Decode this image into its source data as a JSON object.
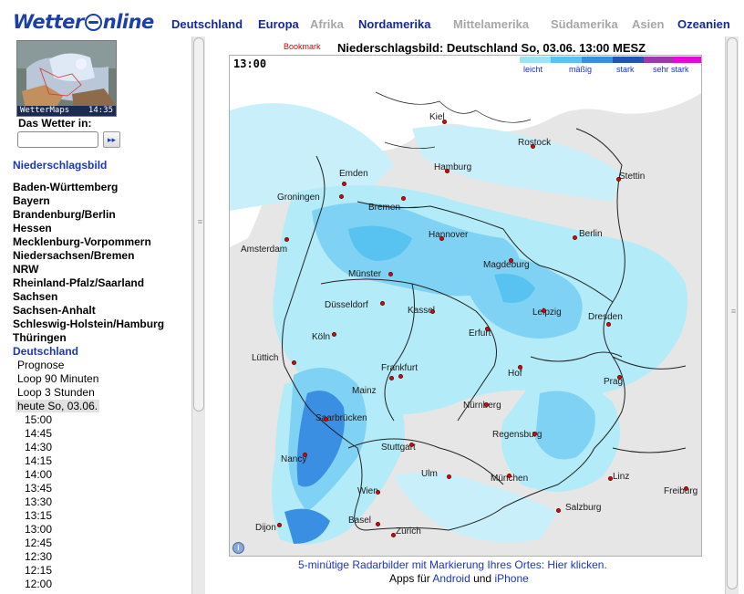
{
  "header": {
    "logo": "WetterOnline",
    "nav": [
      {
        "label": "Deutschland",
        "active": true
      },
      {
        "label": "Europa",
        "active": true
      },
      {
        "label": "Afrika",
        "active": false
      },
      {
        "label": "Nordamerika",
        "active": true
      },
      {
        "label": "Mittelamerika",
        "active": false
      },
      {
        "label": "Südamerika",
        "active": false
      },
      {
        "label": "Asien",
        "active": false
      },
      {
        "label": "Ozeanien",
        "active": true
      }
    ]
  },
  "sidebar": {
    "thumbnail": {
      "caption_left": "WetterMaps",
      "caption_right": "14:35"
    },
    "search_label": "Das Wetter in:",
    "search_value": "",
    "go_button": "▸▸",
    "section_title": "Niederschlagsbild",
    "regions": [
      "Baden-Württemberg",
      "Bayern",
      "Brandenburg/Berlin",
      "Hessen",
      "Mecklenburg-Vorpommern",
      "Niedersachsen/Bremen",
      "NRW",
      "Rheinland-Pfalz/Saarland",
      "Sachsen",
      "Sachsen-Anhalt",
      "Schleswig-Holstein/Hamburg",
      "Thüringen"
    ],
    "current_region": "Deutschland",
    "sub_items": [
      "Prognose",
      "Loop 90 Minuten",
      "Loop 3 Stunden"
    ],
    "selected_day": "heute So, 03.06.",
    "times": [
      "15:00",
      "14:45",
      "14:30",
      "14:15",
      "14:00",
      "13:45",
      "13:30",
      "13:15",
      "13:00",
      "12:45",
      "12:30",
      "12:15",
      "12:00"
    ]
  },
  "main": {
    "bookmark": "Bookmark",
    "title": "Niederschlagsbild: Deutschland So, 03.06. 13:00 MESZ",
    "map_time": "13:00",
    "legend": {
      "labels": [
        "leicht",
        "mäßig",
        "stark",
        "sehr stark"
      ],
      "colors": [
        "#9fe4f5",
        "#58c2f0",
        "#3a8fe3",
        "#2352b8",
        "#9b3aa8",
        "#e40ad8"
      ]
    },
    "cities": [
      {
        "name": "Kiel"
      },
      {
        "name": "Rostock"
      },
      {
        "name": "Emden"
      },
      {
        "name": "Hamburg"
      },
      {
        "name": "Stettin"
      },
      {
        "name": "Groningen"
      },
      {
        "name": "Bremen"
      },
      {
        "name": "Hannover"
      },
      {
        "name": "Berlin"
      },
      {
        "name": "Amsterdam"
      },
      {
        "name": "Magdeburg"
      },
      {
        "name": "Münster"
      },
      {
        "name": "Düsseldorf"
      },
      {
        "name": "Kassel"
      },
      {
        "name": "Leipzig"
      },
      {
        "name": "Dresden"
      },
      {
        "name": "Köln"
      },
      {
        "name": "Erfurt"
      },
      {
        "name": "Lüttich"
      },
      {
        "name": "Frankfurt"
      },
      {
        "name": "Hof"
      },
      {
        "name": "Prag"
      },
      {
        "name": "Mainz"
      },
      {
        "name": "Nürnberg"
      },
      {
        "name": "Saarbrücken"
      },
      {
        "name": "Regensburg"
      },
      {
        "name": "Stuttgart"
      },
      {
        "name": "Nancy"
      },
      {
        "name": "Ulm"
      },
      {
        "name": "München"
      },
      {
        "name": "Linz"
      },
      {
        "name": "Freiburg"
      },
      {
        "name": "Wien"
      },
      {
        "name": "Salzburg"
      },
      {
        "name": "Basel"
      },
      {
        "name": "Dijon"
      },
      {
        "name": "Zürich"
      }
    ],
    "radar_link": "5-minütige Radarbilder mit Markierung Ihres Ortes: Hier klicken.",
    "apps": {
      "prefix": "Apps für ",
      "android": "Android",
      "middle": " und ",
      "iphone": "iPhone"
    }
  }
}
